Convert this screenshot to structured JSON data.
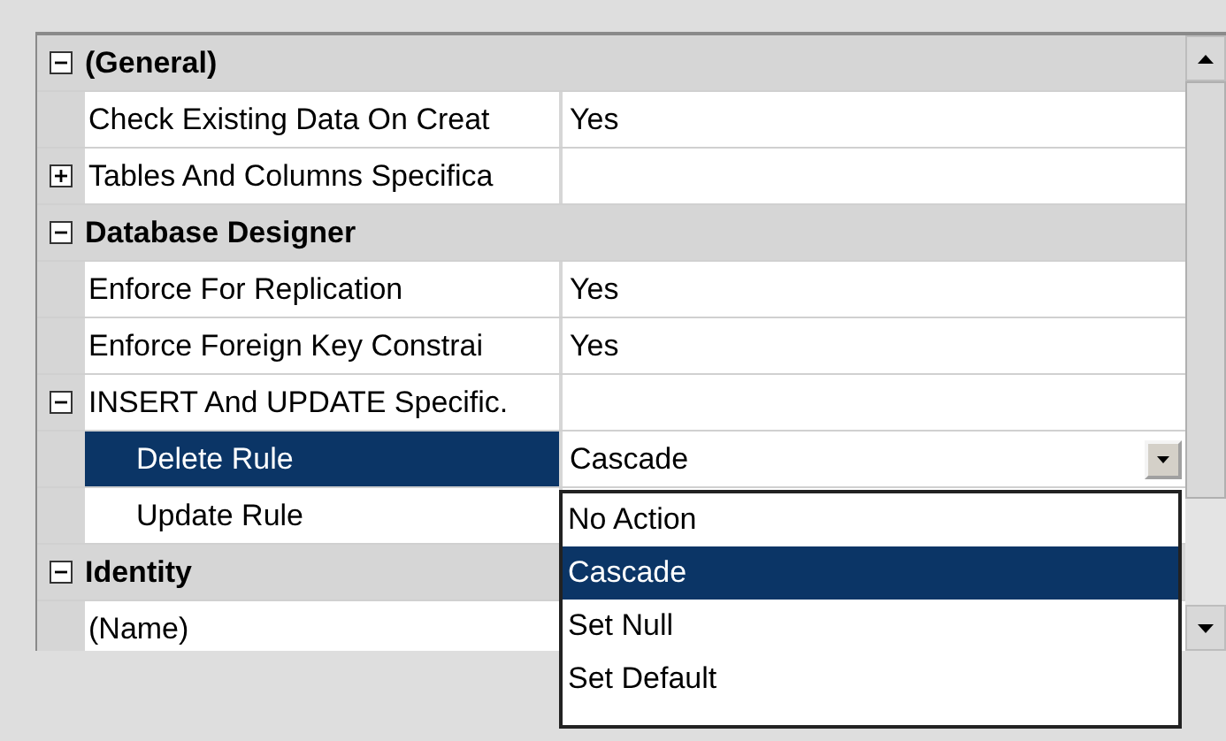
{
  "categories": [
    {
      "title": "(General)",
      "expanded": true,
      "properties": [
        {
          "name": "Check Existing Data On Creat",
          "value": "Yes",
          "selected": false
        },
        {
          "name": "Tables And Columns Specifica",
          "expanded": false,
          "selected": false
        }
      ]
    },
    {
      "title": "Database Designer",
      "expanded": true,
      "properties": [
        {
          "name": "Enforce For Replication",
          "value": "Yes",
          "selected": false
        },
        {
          "name": "Enforce Foreign Key Constrai",
          "value": "Yes",
          "selected": false
        },
        {
          "name": "INSERT And UPDATE Specific.",
          "expanded": true,
          "selected": false,
          "children": [
            {
              "name": "Delete Rule",
              "value": "Cascade",
              "kind": "dropdown",
              "selected": true
            },
            {
              "name": "Update Rule",
              "selected": false
            }
          ]
        }
      ]
    },
    {
      "title": "Identity",
      "expanded": true,
      "properties": [
        {
          "name": "(Name)",
          "selected": false
        }
      ]
    }
  ],
  "dropdown": {
    "options": [
      {
        "label": "No Action",
        "selected": false
      },
      {
        "label": "Cascade",
        "selected": true
      },
      {
        "label": "Set Null",
        "selected": false
      },
      {
        "label": "Set Default",
        "selected": false
      }
    ]
  }
}
